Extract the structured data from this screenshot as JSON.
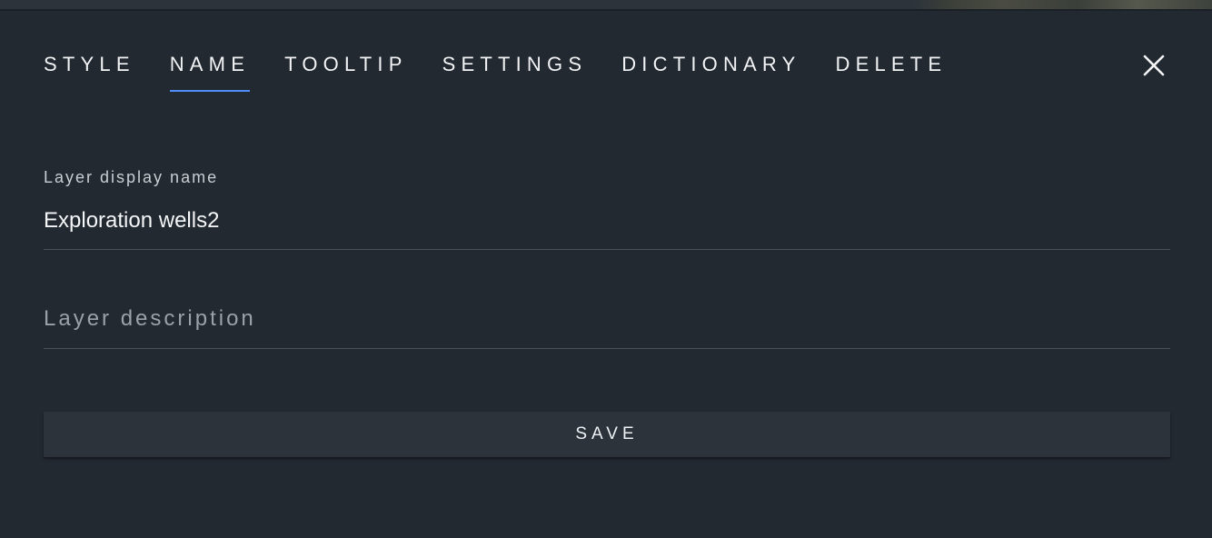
{
  "tabs": [
    {
      "label": "STYLE",
      "active": false
    },
    {
      "label": "NAME",
      "active": true
    },
    {
      "label": "TOOLTIP",
      "active": false
    },
    {
      "label": "SETTINGS",
      "active": false
    },
    {
      "label": "DICTIONARY",
      "active": false
    },
    {
      "label": "DELETE",
      "active": false
    }
  ],
  "close_icon": "close-icon",
  "form": {
    "display_name_label": "Layer display name",
    "display_name_value": "Exploration wells2",
    "description_placeholder": "Layer description",
    "description_value": ""
  },
  "save_label": "SAVE",
  "colors": {
    "panel_background": "#232931",
    "accent": "#4f8df7",
    "button_background": "#2c333b"
  }
}
